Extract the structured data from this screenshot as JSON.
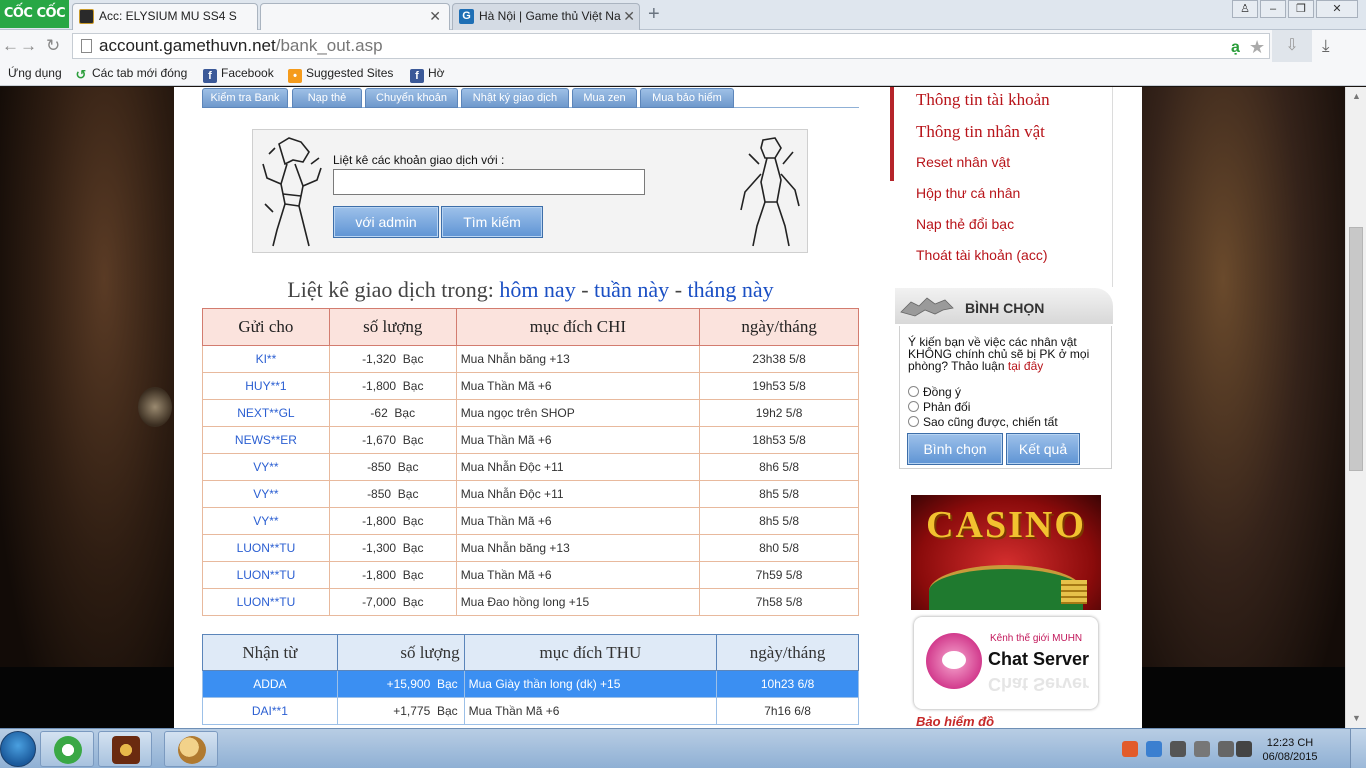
{
  "browser": {
    "brand": "CỐC CỐC",
    "tabs": [
      {
        "title": "Acc: ELYSIUM MU SS4 S"
      },
      {
        "title": ""
      },
      {
        "title": "Hà Nội | Game thủ Việt Na"
      }
    ],
    "url_host": "account.gamethuvn.net",
    "url_path": "/bank_out.asp",
    "bookmarks": [
      "Ứng dụng",
      "Các tab mới đóng",
      "Facebook",
      "Suggested Sites",
      "Hờ"
    ]
  },
  "subnav": [
    "Kiểm tra Bank",
    "Nạp thẻ",
    "Chuyển khoản",
    "Nhật ký giao dịch",
    "Mua zen",
    "Mua bảo hiểm"
  ],
  "search": {
    "label": "Liệt kê các khoản giao dịch với :",
    "value": "",
    "btn_admin": "với admin",
    "btn_search": "Tìm kiếm"
  },
  "list_title": {
    "prefix": "Liệt kê giao dịch trong:",
    "today": "hôm nay",
    "sep1": " - ",
    "week": "tuần này",
    "sep2": " - ",
    "month": "tháng này"
  },
  "chi_table": {
    "headers": [
      "Gửi cho",
      "số lượng",
      "mục đích CHI",
      "ngày/tháng"
    ],
    "rows": [
      {
        "name": "KI**",
        "amount": "-1,320",
        "unit": "Bạc",
        "purpose": "Mua Nhẫn băng +13",
        "date": "23h38 5/8"
      },
      {
        "name": "HUY**1",
        "amount": "-1,800",
        "unit": "Bạc",
        "purpose": "Mua Thần Mã +6",
        "date": "19h53 5/8"
      },
      {
        "name": "NEXT**GL",
        "amount": "-62",
        "unit": "Bạc",
        "purpose": "Mua ngọc trên SHOP",
        "date": "19h2 5/8"
      },
      {
        "name": "NEWS**ER",
        "amount": "-1,670",
        "unit": "Bạc",
        "purpose": "Mua Thần Mã +6",
        "date": "18h53 5/8"
      },
      {
        "name": "VY**",
        "amount": "-850",
        "unit": "Bạc",
        "purpose": "Mua Nhẫn Độc +11",
        "date": "8h6 5/8"
      },
      {
        "name": "VY**",
        "amount": "-850",
        "unit": "Bạc",
        "purpose": "Mua Nhẫn Độc +11",
        "date": "8h5 5/8"
      },
      {
        "name": "VY**",
        "amount": "-1,800",
        "unit": "Bạc",
        "purpose": "Mua Thần Mã +6",
        "date": "8h5 5/8"
      },
      {
        "name": "LUON**TU",
        "amount": "-1,300",
        "unit": "Bạc",
        "purpose": "Mua Nhẫn băng +13",
        "date": "8h0 5/8"
      },
      {
        "name": "LUON**TU",
        "amount": "-1,800",
        "unit": "Bạc",
        "purpose": "Mua Thần Mã +6",
        "date": "7h59 5/8"
      },
      {
        "name": "LUON**TU",
        "amount": "-7,000",
        "unit": "Bạc",
        "purpose": "Mua Đao hồng long +15",
        "date": "7h58 5/8"
      }
    ]
  },
  "thu_table": {
    "headers": [
      "Nhận từ",
      "số lượng",
      "mục đích THU",
      "ngày/tháng"
    ],
    "rows": [
      {
        "name": "ADDA",
        "amount": "+15,900",
        "unit": "Bạc",
        "purpose": "Mua Giày thần long (dk) +15",
        "date": "10h23 6/8",
        "selected": true
      },
      {
        "name": "DAI**1",
        "amount": "+1,775",
        "unit": "Bạc",
        "purpose": "Mua Thần Mã +6",
        "date": "7h16 6/8",
        "selected": false
      }
    ]
  },
  "sidebar": {
    "menu": [
      "Thông tin tài khoản",
      "Thông tin nhân vật",
      "Reset nhân vật",
      "Hộp thư cá nhân",
      "Nạp thẻ đổi bạc",
      "Thoát tài khoản (acc)"
    ],
    "poll": {
      "title": "BÌNH CHỌN",
      "question": "Ý kiến bạn về việc các nhân vật KHÔNG chính chủ sẽ bị PK ở mọi phòng? Thảo luận",
      "question_link": "tại đây",
      "options": [
        "Đồng ý",
        "Phản đối",
        "Sao cũng được, chiến tất"
      ],
      "vote_button": "Bình chọn",
      "result_button": "Kết quả"
    },
    "casino_text": "CASINO",
    "chat_sub": "Kênh thế giới MUHN",
    "chat_main": "Chat Server",
    "insurance": "Bảo hiểm đồ"
  },
  "taskbar": {
    "time": "12:23 CH",
    "date": "06/08/2015"
  },
  "colors": {
    "link_blue": "#2b5fd2",
    "menu_red": "#b8141a",
    "button_blue": "#5f94d4",
    "chi_header": "#fbe3dd",
    "thu_header": "#dfeaf7",
    "selection": "#3b8ff2"
  }
}
